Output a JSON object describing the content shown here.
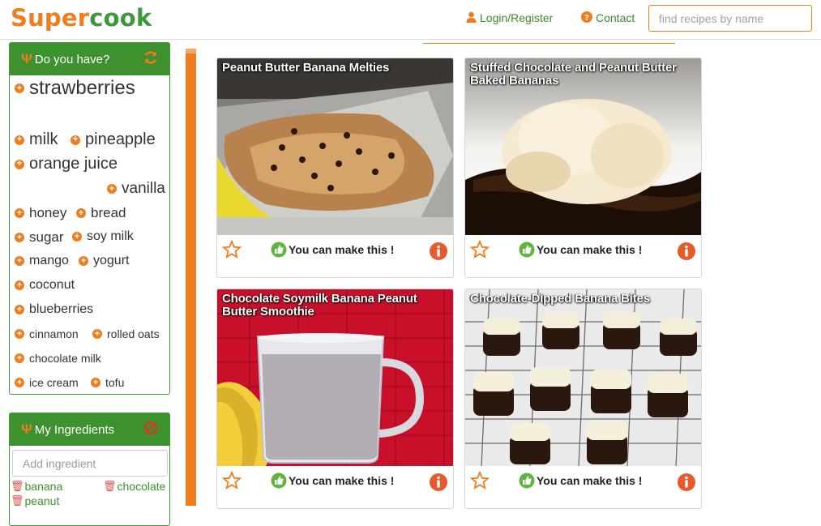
{
  "app": {
    "logo_part1": "Super",
    "logo_part2": "cook",
    "login_label": "Login/Register",
    "contact_label": "Contact",
    "search_placeholder": "find recipes by name"
  },
  "do_you_have": {
    "title": "Do you have?",
    "items": [
      "strawberries",
      "milk",
      "pineapple",
      "orange juice",
      "vanilla",
      "honey",
      "bread",
      "sugar",
      "soy milk",
      "mango",
      "yogurt",
      "coconut",
      "blueberries",
      "cinnamon",
      "rolled oats",
      "chocolate milk",
      "ice cream",
      "tofu"
    ]
  },
  "my_ingredients": {
    "title": "My Ingredients",
    "add_placeholder": "Add ingredient",
    "items": [
      "banana",
      "chocolate",
      "peanut"
    ]
  },
  "recipes": [
    {
      "title": "Peanut Butter Banana Melties",
      "status": "You can make this !"
    },
    {
      "title": "Stuffed Chocolate and Peanut Butter Baked Bananas",
      "status": "You can make this !"
    },
    {
      "title": "Chocolate Soymilk Banana Peanut Butter Smoothie",
      "status": "You can make this !"
    },
    {
      "title": "Chocolate-Dipped Banana Bites",
      "status": "You can make this !"
    }
  ],
  "colors": {
    "brand_orange": "#ef7d1e",
    "brand_green": "#3d922f",
    "info_red": "#e8592c"
  },
  "icons": {
    "login": "user-icon",
    "contact": "question-circle-icon",
    "panel_head": "fork-knife-icon",
    "refresh": "refresh-icon",
    "clear": "ban-icon",
    "add": "plus-circle-icon",
    "remove": "trash-icon",
    "favorite": "star-icon",
    "can_make": "thumbs-up-icon",
    "info": "info-icon"
  }
}
